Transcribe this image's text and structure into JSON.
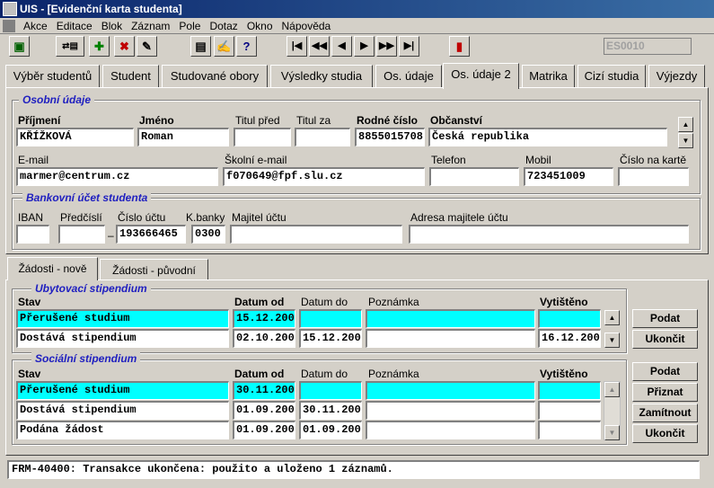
{
  "window": {
    "title": "UIS - [Evidenční karta studenta]"
  },
  "menu": [
    "Akce",
    "Editace",
    "Blok",
    "Záznam",
    "Pole",
    "Dotaz",
    "Okno",
    "Nápověda"
  ],
  "toolbar": {
    "form_code": "ES0010",
    "icons": [
      "save-icon",
      "enter-query-icon",
      "add-record-icon",
      "delete-record-icon",
      "clear-icon",
      "copy-icon",
      "edit-icon",
      "help-icon",
      "first-record-icon",
      "previous-block-icon",
      "previous-record-icon",
      "next-record-icon",
      "next-block-icon",
      "last-record-icon",
      "exit-icon"
    ]
  },
  "tabs": [
    "Výběr studentů",
    "Student",
    "Studované obory",
    "Výsledky studia",
    "Os. údaje",
    "Os. údaje 2",
    "Matrika",
    "Cizí studia",
    "Výjezdy"
  ],
  "personal": {
    "title": "Osobní údaje",
    "lbl_surname": "Příjmení",
    "surname": "KŘÍŽKOVÁ",
    "lbl_name": "Jméno",
    "name": "Roman",
    "lbl_title_before": "Titul před",
    "title_before": "",
    "lbl_title_after": "Titul za",
    "title_after": "",
    "lbl_birth": "Rodné číslo",
    "birth": "8855015708",
    "lbl_citizen": "Občanství",
    "citizen": "Česká republika",
    "lbl_email": "E-mail",
    "email": "marmer@centrum.cz",
    "lbl_school_email": "Školní e-mail",
    "school_email": "f070649@fpf.slu.cz",
    "lbl_phone": "Telefon",
    "phone": "",
    "lbl_mobile": "Mobil",
    "mobile": "723451009",
    "lbl_card": "Číslo na kartě",
    "card": ""
  },
  "bank": {
    "title": "Bankovní účet studenta",
    "lbl_iban": "IBAN",
    "iban": "",
    "lbl_prefix": "Předčíslí",
    "prefix": "",
    "dash": "–",
    "lbl_account": "Číslo účtu",
    "account": "193666465",
    "lbl_bank": "K.banky",
    "bank_code": "0300",
    "lbl_owner": "Majitel účtu",
    "owner": "",
    "lbl_owner_addr": "Adresa majitele účtu",
    "owner_addr": ""
  },
  "subtabs": [
    "Žádosti - nově",
    "Žádosti - původní"
  ],
  "accom": {
    "title": "Ubytovací stipendium",
    "h_state": "Stav",
    "h_from": "Datum od",
    "h_to": "Datum do",
    "h_note": "Poznámka",
    "h_printed": "Vytištěno",
    "rows": [
      {
        "state": "Přerušené studium",
        "from": "15.12.2009",
        "to": "",
        "note": "",
        "printed": ""
      },
      {
        "state": "Dostává stipendium",
        "from": "02.10.2008",
        "to": "15.12.2009",
        "note": "",
        "printed": "16.12.2008"
      }
    ],
    "btn_submit": "Podat",
    "btn_end": "Ukončit"
  },
  "social": {
    "title": "Sociální stipendium",
    "h_state": "Stav",
    "h_from": "Datum od",
    "h_to": "Datum do",
    "h_note": "Poznámka",
    "h_printed": "Vytištěno",
    "rows": [
      {
        "state": "Přerušené studium",
        "from": "30.11.2009",
        "to": "",
        "note": "",
        "printed": ""
      },
      {
        "state": "Dostává stipendium",
        "from": "01.09.2009",
        "to": "30.11.2009",
        "note": "",
        "printed": ""
      },
      {
        "state": "Podána žádost",
        "from": "01.09.2009",
        "to": "01.09.2009",
        "note": "",
        "printed": ""
      }
    ],
    "btn_submit": "Podat",
    "btn_grant": "Přiznat",
    "btn_reject": "Zamítnout",
    "btn_end": "Ukončit"
  },
  "status": "FRM-40400: Transakce ukončena: použito a uloženo 1 záznamů.",
  "colors": {
    "highlight": "#00ffff",
    "group_title": "#2020c0",
    "title_bar": "#0a246a"
  }
}
